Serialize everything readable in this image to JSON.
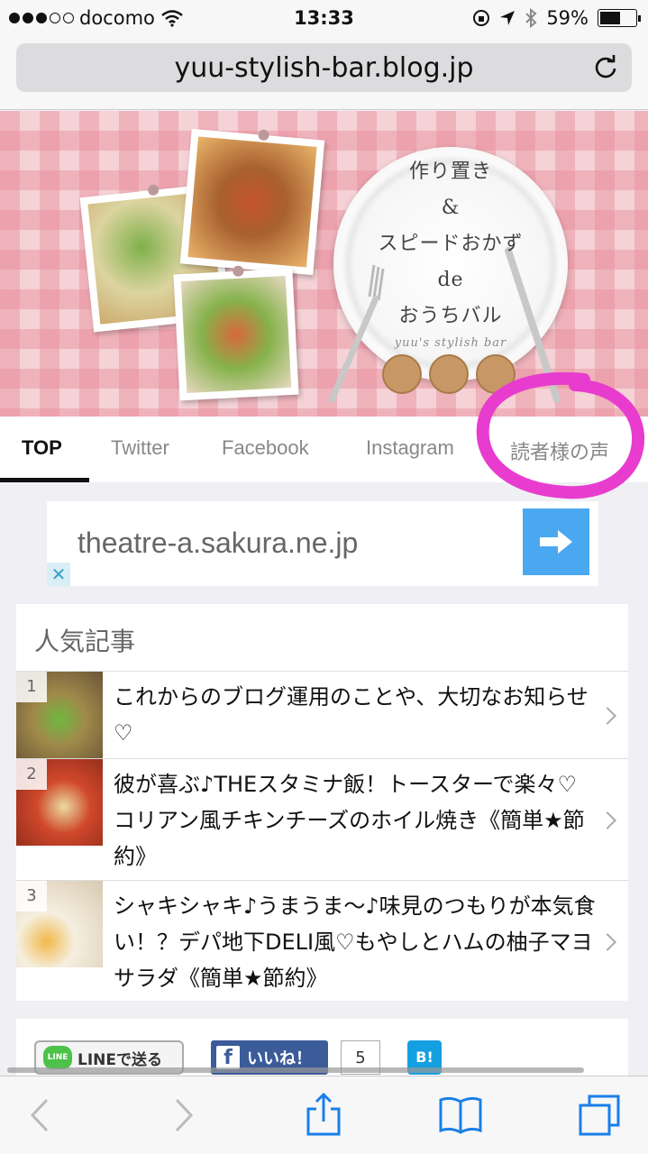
{
  "status_bar": {
    "carrier": "docomo",
    "time": "13:33",
    "battery": "59%"
  },
  "browser": {
    "url": "yuu-stylish-bar.blog.jp"
  },
  "banner": {
    "line1": "作り置き",
    "line2": "&",
    "line3": "スピードおかず",
    "line4": "de",
    "line5": "おうちバル",
    "tagline": "yuu's stylish bar"
  },
  "tabs": [
    {
      "label": "TOP"
    },
    {
      "label": "Twitter"
    },
    {
      "label": "Facebook"
    },
    {
      "label": "Instagram"
    },
    {
      "label": "読者様の声"
    }
  ],
  "ad": {
    "domain": "theatre-a.sakura.ne.jp",
    "close": "✕"
  },
  "popular": {
    "title": "人気記事",
    "articles": [
      {
        "rank": "1",
        "title": "これからのブログ運用のことや、大切なお知らせ♡"
      },
      {
        "rank": "2",
        "title": "彼が喜ぶ♪THEスタミナ飯！トースターで楽々♡コリアン風チキンチーズのホイル焼き《簡単★節約》"
      },
      {
        "rank": "3",
        "title": "シャキシャキ♪うまうま〜♪味見のつもりが本気食い！？デパ地下DELI風♡もやしとハムの柚子マヨサラダ《簡単★節約》"
      }
    ]
  },
  "share": {
    "line_logo": "LINE",
    "line_label": "LINEで送る",
    "fb_icon": "f",
    "fb_label": "いいね！",
    "fb_count": "5",
    "hatena": "B!"
  },
  "colors": {
    "accent_tab": "#111111",
    "ad_arrow": "#4aa8f0",
    "highlight_circle": "#e83ccf"
  }
}
